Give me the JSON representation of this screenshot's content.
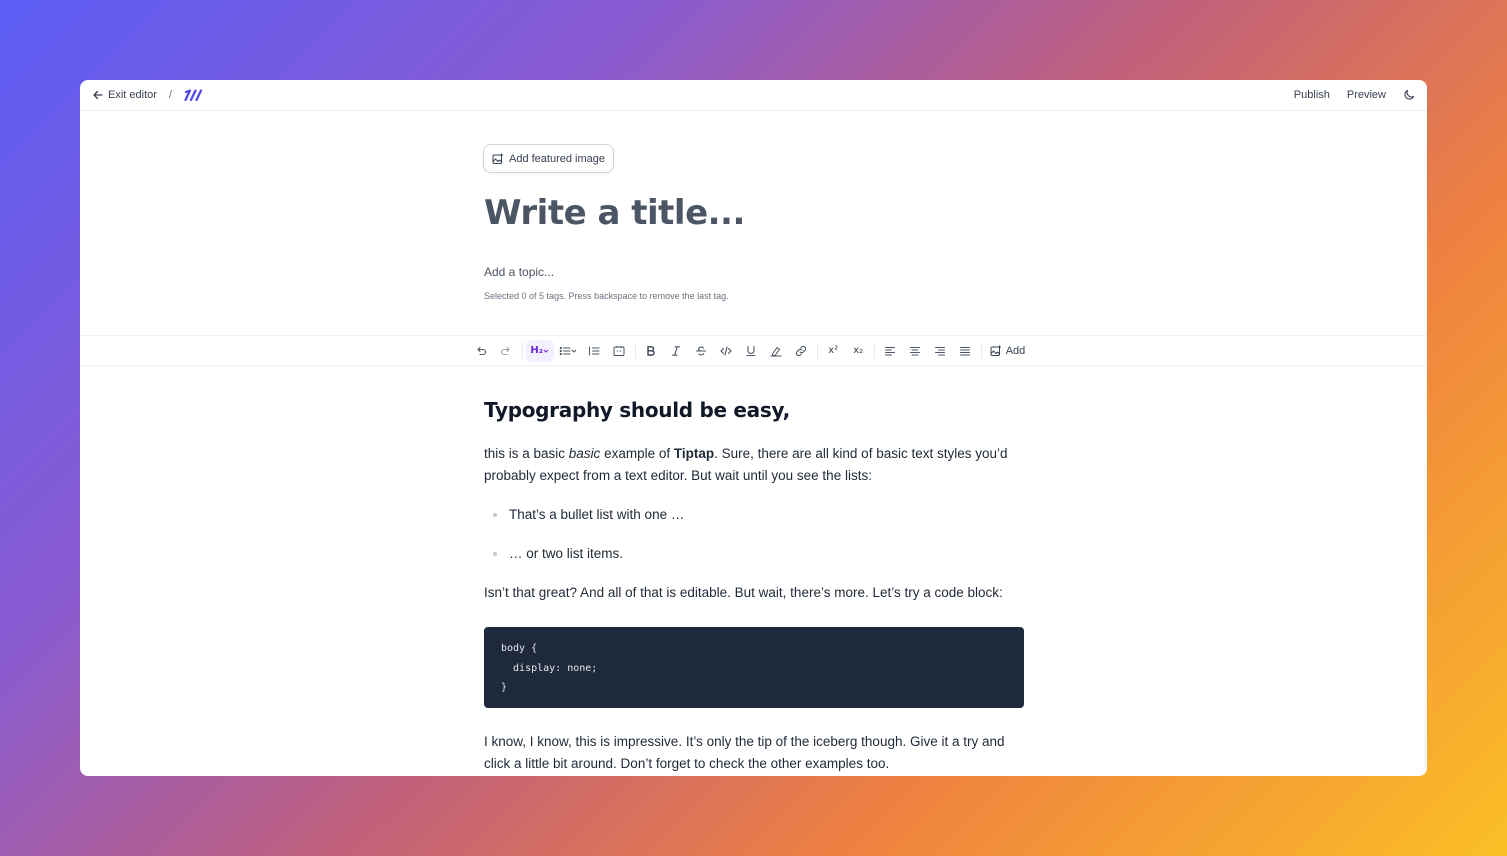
{
  "topbar": {
    "exit_label": "Exit editor",
    "separator": "/",
    "publish_label": "Publish",
    "preview_label": "Preview"
  },
  "header": {
    "featured_image_label": "Add featured image",
    "title_placeholder": "Write a title...",
    "topic_placeholder": "Add a topic...",
    "tags_hint": "Selected 0 of 5 tags. Press backspace to remove the last tag."
  },
  "toolbar": {
    "heading_label": "H₂",
    "superscript_label": "x²",
    "subscript_label": "x₂",
    "add_label": "Add",
    "tools": [
      "undo-icon",
      "redo-icon",
      "heading-icon",
      "bullet-list-icon",
      "ordered-list-icon",
      "code-block-icon",
      "bold-icon",
      "italic-icon",
      "strike-icon",
      "code-icon",
      "underline-icon",
      "highlight-icon",
      "link-icon",
      "superscript-icon",
      "subscript-icon",
      "align-left-icon",
      "align-center-icon",
      "align-right-icon",
      "align-justify-icon",
      "image-add-icon"
    ]
  },
  "document": {
    "heading": "Typography should be easy,",
    "p1_before": "this is a basic ",
    "p1_italic": "basic",
    "p1_middle": " example of ",
    "p1_bold": "Tiptap",
    "p1_after": ". Sure, there are all kind of basic text styles you’d probably expect from a text editor. But wait until you see the lists:",
    "list_items": [
      "That’s a bullet list with one …",
      "… or two list items."
    ],
    "p2": "Isn’t that great? And all of that is editable. But wait, there’s more. Let’s try a code block:",
    "code": "body {\n  display: none;\n}",
    "p3": "I know, I know, this is impressive. It’s only the tip of the iceberg though. Give it a try and click a little bit around. Don’t forget to check the other examples too."
  },
  "colors": {
    "accent": "#6d28d9",
    "code_bg": "#1e293b",
    "logo": "#4f46e5"
  }
}
